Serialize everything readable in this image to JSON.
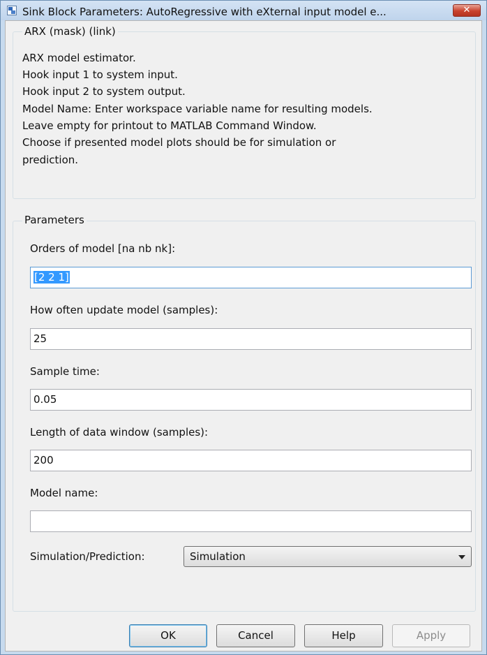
{
  "window": {
    "title": "Sink Block Parameters: AutoRegressive with eXternal input model e...",
    "close_glyph": "✕",
    "title_icon": "simulink-block-icon",
    "close_color": "#c9422d"
  },
  "mask": {
    "group_title": "ARX (mask) (link)",
    "description_lines": [
      "ARX model estimator.",
      "Hook input 1 to system input.",
      "Hook input 2 to system output.",
      "Model Name: Enter workspace variable name for resulting models.",
      "Leave empty for printout to MATLAB Command Window.",
      "Choose if presented model plots should be for simulation or",
      "prediction."
    ]
  },
  "parameters": {
    "group_title": "Parameters",
    "orders": {
      "label": "Orders of model [na nb nk]:",
      "value": "[2 2 1]"
    },
    "update": {
      "label": "How often update model (samples):",
      "value": "25"
    },
    "sample_time": {
      "label": "Sample time:",
      "value": "0.05"
    },
    "data_window": {
      "label": "Length of data window (samples):",
      "value": "200"
    },
    "model_name": {
      "label": "Model name:",
      "value": ""
    },
    "sim_pred": {
      "label": "Simulation/Prediction:",
      "selected": "Simulation"
    }
  },
  "buttons": {
    "ok": "OK",
    "cancel": "Cancel",
    "help": "Help",
    "apply": "Apply"
  }
}
